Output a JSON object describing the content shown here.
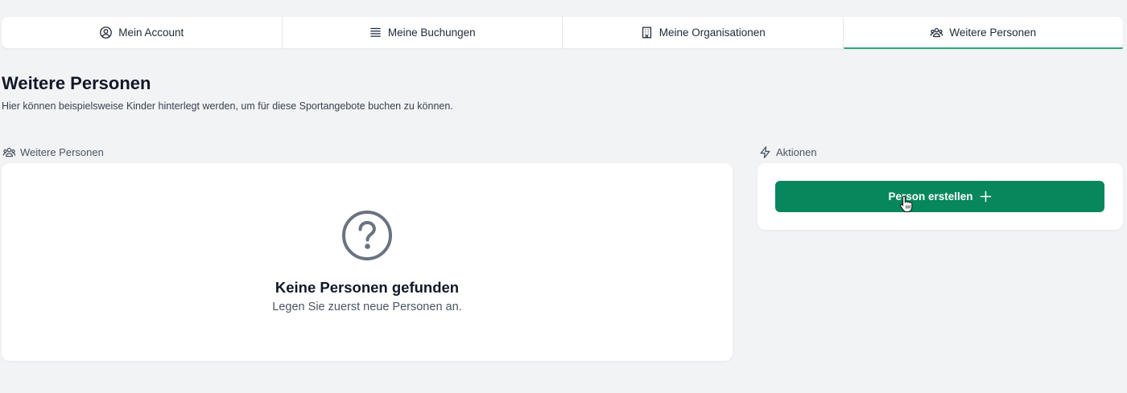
{
  "tabs": [
    {
      "label": "Mein Account",
      "icon": "user-circle-icon"
    },
    {
      "label": "Meine Buchungen",
      "icon": "list-icon"
    },
    {
      "label": "Meine Organisationen",
      "icon": "building-icon"
    },
    {
      "label": "Weitere Personen",
      "icon": "users-icon",
      "active": true
    }
  ],
  "page": {
    "title": "Weitere Personen",
    "subtitle": "Hier können beispielsweise Kinder hinterlegt werden, um für diese Sportangebote buchen zu können."
  },
  "persons_section": {
    "label": "Weitere Personen",
    "empty_title": "Keine Personen gefunden",
    "empty_description": "Legen Sie zuerst neue Personen an."
  },
  "actions_section": {
    "label": "Aktionen",
    "create_button_label": "Person erstellen"
  },
  "colors": {
    "accent": "#07875b",
    "active_tab_underline": "#2fa878",
    "background": "#f2f3f5"
  }
}
